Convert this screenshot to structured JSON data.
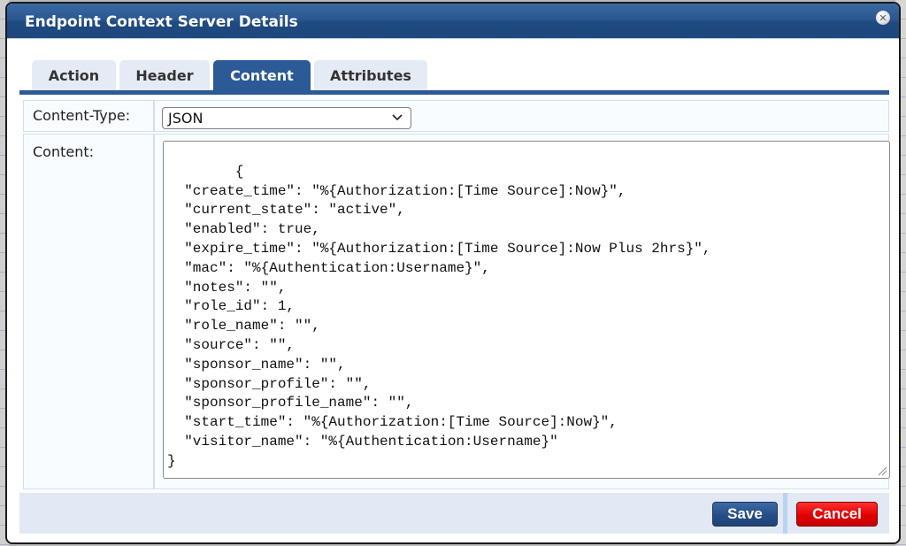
{
  "dialog": {
    "title": "Endpoint Context Server Details",
    "close_icon": "close-circle-icon"
  },
  "tabs": [
    {
      "label": "Action",
      "active": false
    },
    {
      "label": "Header",
      "active": false
    },
    {
      "label": "Content",
      "active": true
    },
    {
      "label": "Attributes",
      "active": false
    }
  ],
  "form": {
    "content_type_label": "Content-Type:",
    "content_type_value": "JSON",
    "content_label": "Content:",
    "content_value": "{\n  \"create_time\": \"%{Authorization:[Time Source]:Now}\",\n  \"current_state\": \"active\",\n  \"enabled\": true,\n  \"expire_time\": \"%{Authorization:[Time Source]:Now Plus 2hrs}\",\n  \"mac\": \"%{Authentication:Username}\",\n  \"notes\": \"\",\n  \"role_id\": 1,\n  \"role_name\": \"\",\n  \"source\": \"\",\n  \"sponsor_name\": \"\",\n  \"sponsor_profile\": \"\",\n  \"sponsor_profile_name\": \"\",\n  \"start_time\": \"%{Authorization:[Time Source]:Now}\",\n  \"visitor_name\": \"%{Authentication:Username}\"\n}"
  },
  "footer": {
    "save_label": "Save",
    "cancel_label": "Cancel"
  },
  "colors": {
    "titlebar": "#2b5790",
    "active_tab": "#2b5a96",
    "inactive_tab": "#e4ebf4",
    "save_button": "#264e86",
    "cancel_button": "#e00000"
  }
}
